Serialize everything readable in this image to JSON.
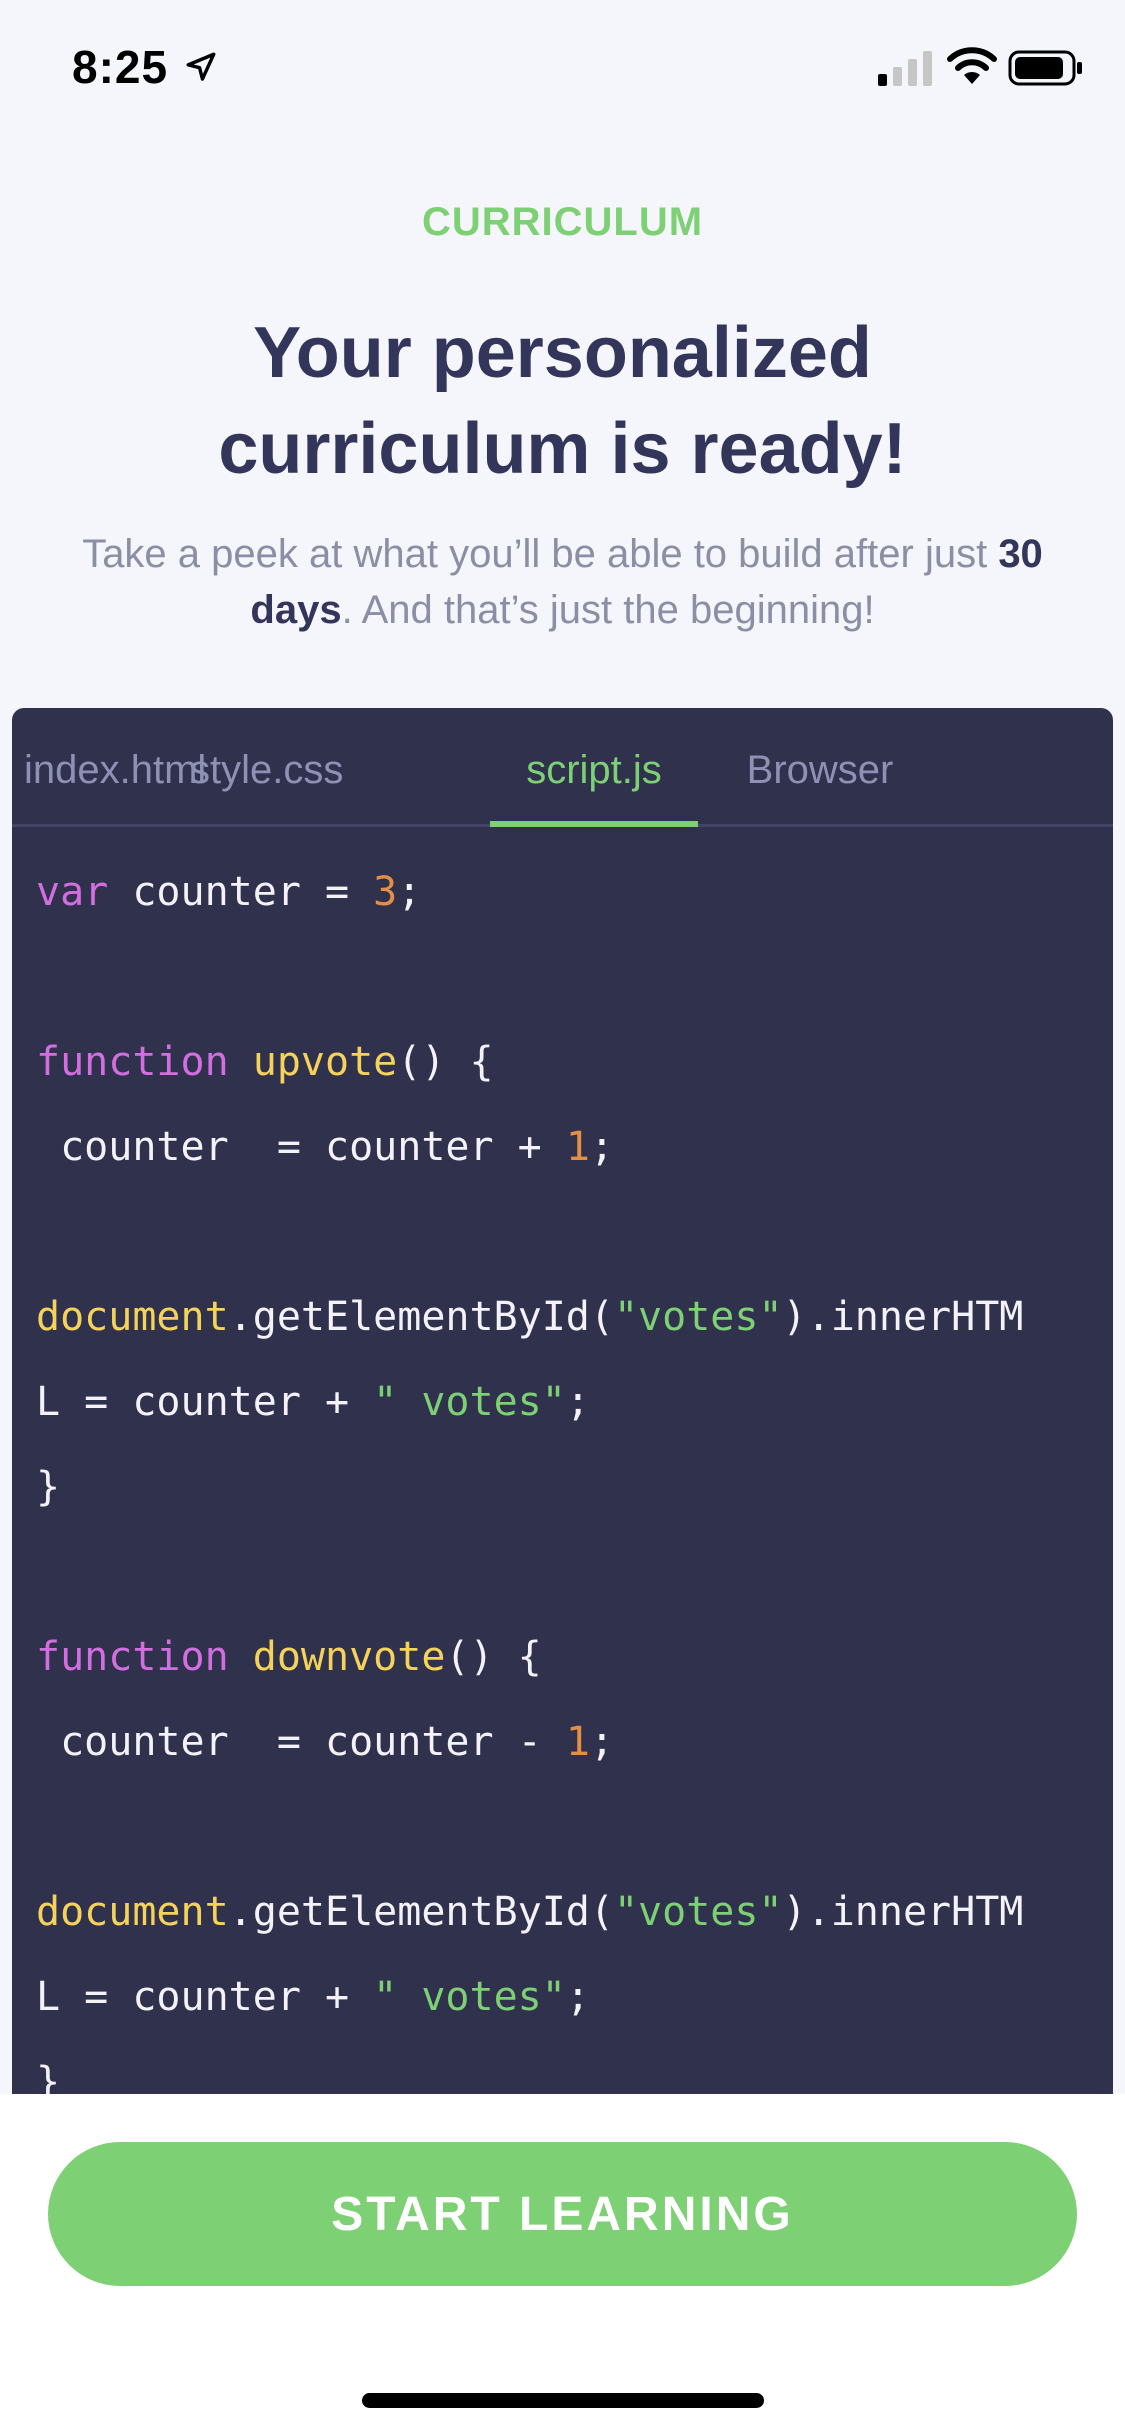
{
  "status_bar": {
    "time": "8:25"
  },
  "header": {
    "eyebrow": "CURRICULUM",
    "title": "Your personalized curriculum is ready!",
    "subtitle_before": "Take a peek at what you’ll be able to build after just ",
    "subtitle_bold": "30 days",
    "subtitle_after": ". And that’s just the beginning!"
  },
  "tabs": [
    {
      "label": "index.html",
      "active": false
    },
    {
      "label": "style.css",
      "active": false
    },
    {
      "label": "script.js",
      "active": true
    },
    {
      "label": "Browser",
      "active": false
    }
  ],
  "code": {
    "l1": {
      "kw": "var",
      "rest": " counter = ",
      "num": "3",
      "end": ";"
    },
    "l2": {
      "kw": "function",
      "fn": "upvote",
      "rest": "() {"
    },
    "l3": {
      "pre": " counter  = counter + ",
      "num": "1",
      "end": ";"
    },
    "l4": {
      "obj": "document",
      "mid": ".getElementById(",
      "str": "\"votes\"",
      "end": ").innerHTM"
    },
    "l5": {
      "pre": "L = counter + ",
      "str": "\" votes\"",
      "end": ";"
    },
    "l6": {
      "text": "}"
    },
    "l7": {
      "kw": "function",
      "fn": "downvote",
      "rest": "() {"
    },
    "l8": {
      "pre": " counter  = counter - ",
      "num": "1",
      "end": ";"
    },
    "l9": {
      "obj": "document",
      "mid": ".getElementById(",
      "str": "\"votes\"",
      "end": ").innerHTM"
    },
    "l10": {
      "pre": "L = counter + ",
      "str": "\" votes\"",
      "end": ";"
    },
    "l11": {
      "text": "}"
    }
  },
  "cta": {
    "label": "START LEARNING"
  },
  "colors": {
    "accent": "#7ed074",
    "heading": "#33355a",
    "panel": "#30314d",
    "keyword": "#d26ee0",
    "function": "#f5d35a",
    "number": "#e58e45"
  }
}
